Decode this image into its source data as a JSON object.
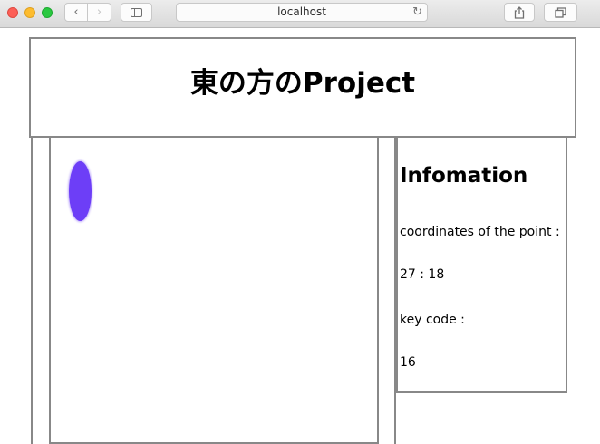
{
  "browser": {
    "url": "localhost",
    "icons": {
      "back": "chevron-left-icon",
      "forward": "chevron-right-icon",
      "sidebar": "sidebar-icon",
      "reload": "reload-icon",
      "share": "share-icon",
      "tabs": "tabs-icon"
    }
  },
  "page": {
    "title": "東の方のProject",
    "info": {
      "heading": "Infomation",
      "coords_label": "coordinates of the point :",
      "coords_value": "27 : 18",
      "key_label": "key code :",
      "key_value": "16"
    },
    "player": {
      "color": "#6d3ef7"
    }
  },
  "colors": {
    "border": "#888888",
    "background": "#ffffff"
  }
}
